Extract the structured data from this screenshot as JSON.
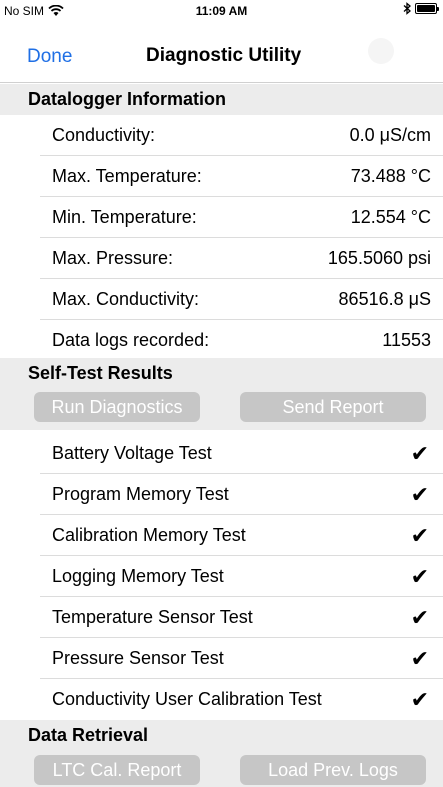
{
  "status_bar": {
    "carrier": "No SIM",
    "time": "11:09 AM",
    "battery_level": 1.0
  },
  "nav": {
    "done_label": "Done",
    "title": "Diagnostic Utility"
  },
  "datalogger": {
    "header": "Datalogger Information",
    "rows": [
      {
        "label": "Conductivity:",
        "value": "0.0 μS/cm"
      },
      {
        "label": "Max. Temperature:",
        "value": "73.488 °C"
      },
      {
        "label": "Min. Temperature:",
        "value": "12.554 °C"
      },
      {
        "label": "Max. Pressure:",
        "value": "165.5060 psi"
      },
      {
        "label": "Max. Conductivity:",
        "value": "86516.8 μS"
      },
      {
        "label": "Data logs recorded:",
        "value": "11553"
      }
    ]
  },
  "self_test": {
    "header": "Self-Test Results",
    "run_diagnostics_label": "Run Diagnostics",
    "send_report_label": "Send Report",
    "tests": [
      {
        "label": "Battery Voltage Test",
        "status": "✔"
      },
      {
        "label": "Program Memory Test",
        "status": "✔"
      },
      {
        "label": "Calibration Memory Test",
        "status": "✔"
      },
      {
        "label": "Logging Memory Test",
        "status": "✔"
      },
      {
        "label": "Temperature Sensor Test",
        "status": "✔"
      },
      {
        "label": "Pressure Sensor Test",
        "status": "✔"
      },
      {
        "label": "Conductivity User Calibration Test",
        "status": "✔"
      }
    ]
  },
  "data_retrieval": {
    "header": "Data Retrieval",
    "ltc_report_label": "LTC Cal. Report",
    "load_logs_label": "Load Prev. Logs"
  }
}
